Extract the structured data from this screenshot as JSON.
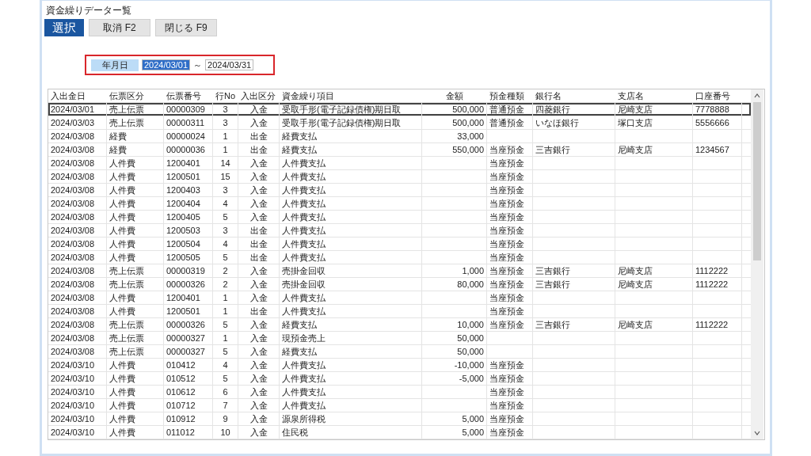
{
  "window": {
    "title": "資金繰りデーター覧"
  },
  "buttons": [
    {
      "label": "選択",
      "kind": "primary"
    },
    {
      "label": "取消 F2",
      "kind": "normal"
    },
    {
      "label": "閉じる F9",
      "kind": "normal"
    }
  ],
  "date_range": {
    "label": "年月日",
    "from": {
      "value": "2024/03/01",
      "selected": true
    },
    "separator": "～",
    "to": {
      "value": "2024/03/31",
      "selected": false
    }
  },
  "table": {
    "columns": [
      {
        "label": "入出金日"
      },
      {
        "label": "伝票区分"
      },
      {
        "label": "伝票番号"
      },
      {
        "label": "行No"
      },
      {
        "label": "入出区分"
      },
      {
        "label": "資金繰り項目"
      },
      {
        "label": "金額"
      },
      {
        "label": "預金種類"
      },
      {
        "label": "銀行名"
      },
      {
        "label": "支店名"
      },
      {
        "label": "口座番号"
      }
    ],
    "rows": [
      {
        "selected": true,
        "cells": [
          "2024/03/01",
          "売上伝票",
          "00000309",
          "3",
          "入金",
          "受取手形(電子記録債権)期日取",
          "500,000",
          "普通預金",
          "四菱銀行",
          "尼崎支店",
          "7778888"
        ]
      },
      {
        "selected": false,
        "cells": [
          "2024/03/03",
          "売上伝票",
          "00000311",
          "3",
          "入金",
          "受取手形(電子記録債権)期日取",
          "500,000",
          "普通預金",
          "いなほ銀行",
          "塚口支店",
          "5556666"
        ]
      },
      {
        "selected": false,
        "cells": [
          "2024/03/08",
          "経費",
          "00000024",
          "1",
          "出金",
          "経費支払",
          "33,000",
          null,
          null,
          null,
          null
        ]
      },
      {
        "selected": false,
        "cells": [
          "2024/03/08",
          "経費",
          "00000036",
          "1",
          "出金",
          "経費支払",
          "550,000",
          "当座預金",
          "三吉銀行",
          "尼崎支店",
          "1234567"
        ]
      },
      {
        "selected": false,
        "cells": [
          "2024/03/08",
          "人件費",
          "1200401",
          "14",
          "入金",
          "人件費支払",
          null,
          "当座預金",
          null,
          null,
          null
        ]
      },
      {
        "selected": false,
        "cells": [
          "2024/03/08",
          "人件費",
          "1200501",
          "15",
          "入金",
          "人件費支払",
          null,
          "当座預金",
          null,
          null,
          null
        ]
      },
      {
        "selected": false,
        "cells": [
          "2024/03/08",
          "人件費",
          "1200403",
          "3",
          "入金",
          "人件費支払",
          null,
          "当座預金",
          null,
          null,
          null
        ]
      },
      {
        "selected": false,
        "cells": [
          "2024/03/08",
          "人件費",
          "1200404",
          "4",
          "入金",
          "人件費支払",
          null,
          "当座預金",
          null,
          null,
          null
        ]
      },
      {
        "selected": false,
        "cells": [
          "2024/03/08",
          "人件費",
          "1200405",
          "5",
          "入金",
          "人件費支払",
          null,
          "当座預金",
          null,
          null,
          null
        ]
      },
      {
        "selected": false,
        "cells": [
          "2024/03/08",
          "人件費",
          "1200503",
          "3",
          "出金",
          "人件費支払",
          null,
          "当座預金",
          null,
          null,
          null
        ]
      },
      {
        "selected": false,
        "cells": [
          "2024/03/08",
          "人件費",
          "1200504",
          "4",
          "出金",
          "人件費支払",
          null,
          "当座預金",
          null,
          null,
          null
        ]
      },
      {
        "selected": false,
        "cells": [
          "2024/03/08",
          "人件費",
          "1200505",
          "5",
          "出金",
          "人件費支払",
          null,
          "当座預金",
          null,
          null,
          null
        ]
      },
      {
        "selected": false,
        "cells": [
          "2024/03/08",
          "売上伝票",
          "00000319",
          "2",
          "入金",
          "売掛金回収",
          "1,000",
          "当座預金",
          "三吉銀行",
          "尼崎支店",
          "1112222"
        ]
      },
      {
        "selected": false,
        "cells": [
          "2024/03/08",
          "売上伝票",
          "00000326",
          "2",
          "入金",
          "売掛金回収",
          "80,000",
          "当座預金",
          "三吉銀行",
          "尼崎支店",
          "1112222"
        ]
      },
      {
        "selected": false,
        "cells": [
          "2024/03/08",
          "人件費",
          "1200401",
          "1",
          "入金",
          "人件費支払",
          null,
          "当座預金",
          null,
          null,
          null
        ]
      },
      {
        "selected": false,
        "cells": [
          "2024/03/08",
          "人件費",
          "1200501",
          "1",
          "出金",
          "人件費支払",
          null,
          "当座預金",
          null,
          null,
          null
        ]
      },
      {
        "selected": false,
        "cells": [
          "2024/03/08",
          "売上伝票",
          "00000326",
          "5",
          "入金",
          "経費支払",
          "10,000",
          "当座預金",
          "三吉銀行",
          "尼崎支店",
          "1112222"
        ]
      },
      {
        "selected": false,
        "cells": [
          "2024/03/08",
          "売上伝票",
          "00000327",
          "1",
          "入金",
          "現預金売上",
          "50,000",
          null,
          null,
          null,
          null
        ]
      },
      {
        "selected": false,
        "cells": [
          "2024/03/08",
          "売上伝票",
          "00000327",
          "5",
          "入金",
          "経費支払",
          "50,000",
          null,
          null,
          null,
          null
        ]
      },
      {
        "selected": false,
        "cells": [
          "2024/03/10",
          "人件費",
          "010412",
          "4",
          "入金",
          "人件費支払",
          "-10,000",
          "当座預金",
          null,
          null,
          null
        ]
      },
      {
        "selected": false,
        "cells": [
          "2024/03/10",
          "人件費",
          "010512",
          "5",
          "入金",
          "人件費支払",
          "-5,000",
          "当座預金",
          null,
          null,
          null
        ]
      },
      {
        "selected": false,
        "cells": [
          "2024/03/10",
          "人件費",
          "010612",
          "6",
          "入金",
          "人件費支払",
          null,
          "当座預金",
          null,
          null,
          null
        ]
      },
      {
        "selected": false,
        "cells": [
          "2024/03/10",
          "人件費",
          "010712",
          "7",
          "入金",
          "人件費支払",
          null,
          "当座預金",
          null,
          null,
          null
        ]
      },
      {
        "selected": false,
        "cells": [
          "2024/03/10",
          "人件費",
          "010912",
          "9",
          "入金",
          "源泉所得税",
          "5,000",
          "当座預金",
          null,
          null,
          null
        ]
      },
      {
        "selected": false,
        "cells": [
          "2024/03/10",
          "人件費",
          "011012",
          "10",
          "入金",
          "住民税",
          "5,000",
          "当座預金",
          null,
          null,
          null
        ]
      }
    ]
  }
}
